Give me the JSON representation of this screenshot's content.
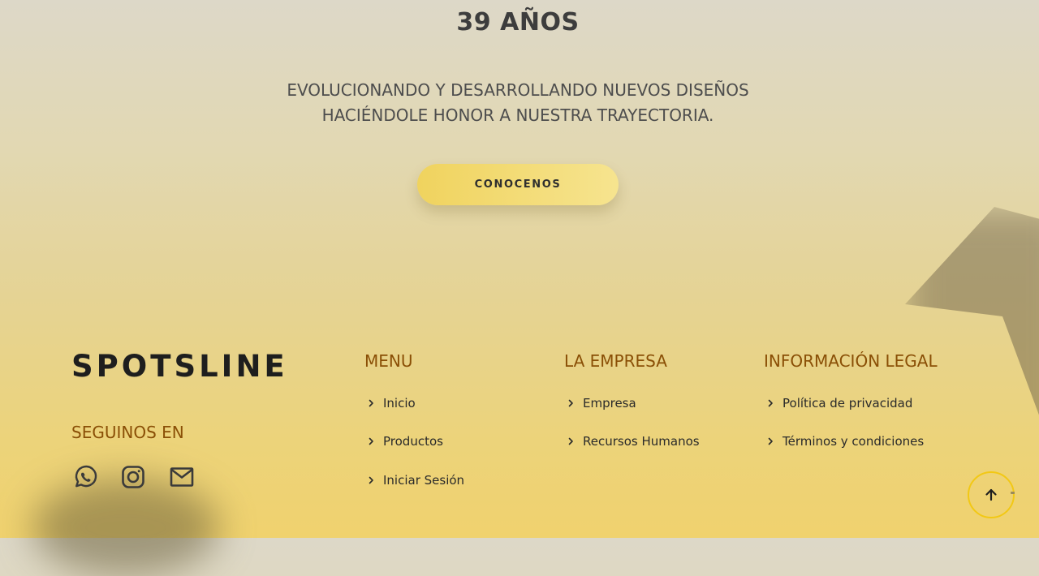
{
  "hero": {
    "title": "39 AÑOS",
    "subtitle_line1": "EVOLUCIONANDO Y DESARROLLANDO NUEVOS DISEÑOS",
    "subtitle_line2": "HACIÉNDOLE HONOR A NUESTRA TRAYECTORIA.",
    "cta_label": "CONOCENOS"
  },
  "footer": {
    "brand": "SPOTSLINE",
    "follow_heading": "SEGUINOS EN",
    "social": [
      {
        "icon": "whatsapp-icon"
      },
      {
        "icon": "instagram-icon"
      },
      {
        "icon": "mail-icon"
      }
    ],
    "columns": [
      {
        "heading": "MENU",
        "links": [
          "Inicio",
          "Productos",
          "Iniciar Sesión"
        ]
      },
      {
        "heading": "LA EMPRESA",
        "links": [
          "Empresa",
          "Recursos Humanos"
        ]
      },
      {
        "heading": "INFORMACIÓN LEGAL",
        "links": [
          "Política de privacidad",
          "Términos y condiciones"
        ]
      }
    ]
  },
  "scroll_top": {
    "icon": "arrow-up-icon"
  },
  "colors": {
    "accent": "#8a4f06",
    "button_gradient_start": "#f0d35e",
    "button_gradient_end": "#f6e48f",
    "scroll_ring": "#f2c814",
    "text_dark": "#2a2a2a"
  }
}
